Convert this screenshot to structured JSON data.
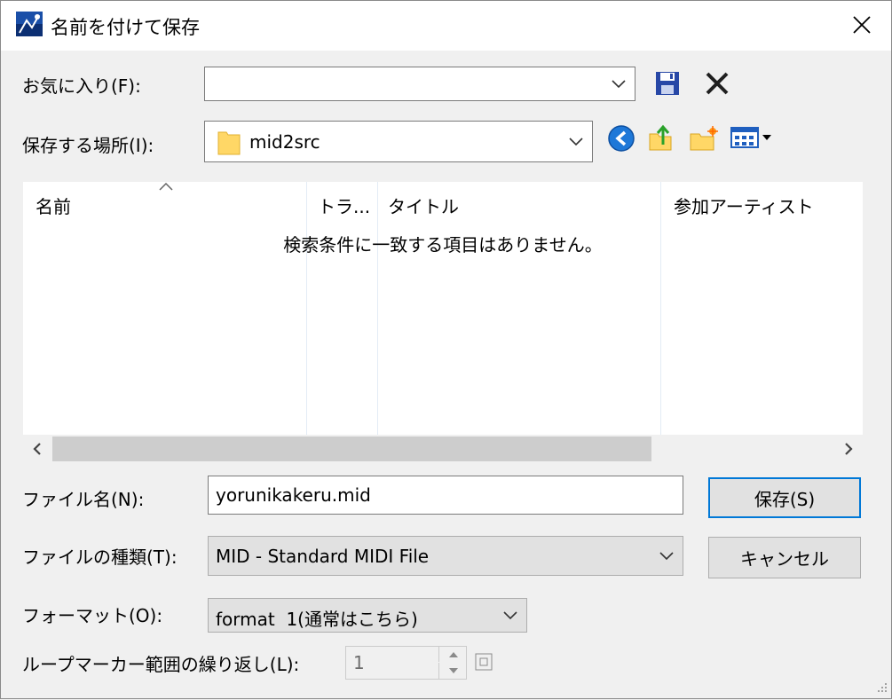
{
  "window": {
    "title": "名前を付けて保存",
    "close_icon": "close-icon"
  },
  "favorites": {
    "label": "お気に入り(F):",
    "value": ""
  },
  "location": {
    "label": "保存する場所(I):",
    "folder": "mid2src"
  },
  "listview": {
    "columns": [
      "名前",
      "トラ...",
      "タイトル",
      "参加アーティスト"
    ],
    "empty_message": "検索条件に一致する項目はありません。"
  },
  "filename": {
    "label": "ファイル名(N):",
    "value": "yorunikakeru.mid"
  },
  "filetype": {
    "label": "ファイルの種類(T):",
    "value": "MID - Standard MIDI File"
  },
  "format": {
    "label": "フォーマット(O):",
    "value": "format  1(通常はこちら)"
  },
  "loop": {
    "label": "ループマーカー範囲の繰り返し(L):",
    "value": "1"
  },
  "buttons": {
    "save": "保存(S)",
    "cancel": "キャンセル"
  },
  "scroll": {
    "left_arrow": "<",
    "right_arrow": ">"
  },
  "colors": {
    "accent": "#0078d7",
    "folder": "#ffd766",
    "nav_back": "#1e78d8"
  }
}
